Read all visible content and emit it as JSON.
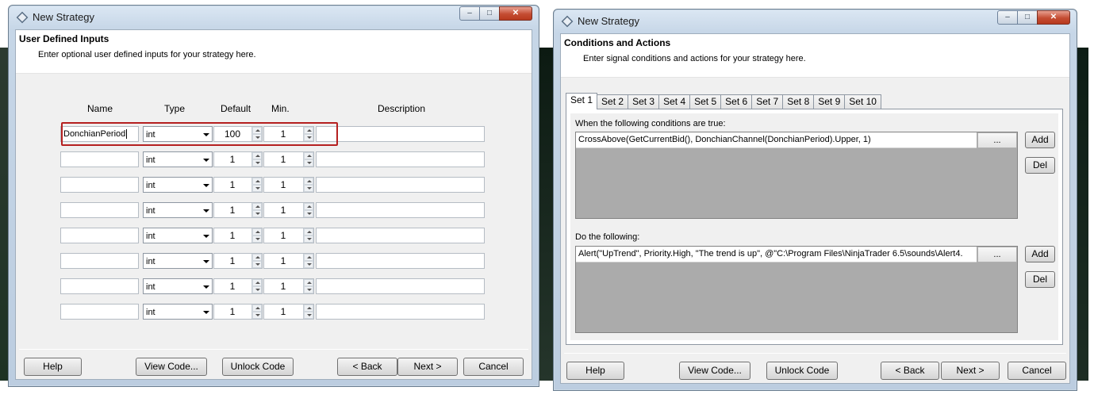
{
  "left_window": {
    "title": "New Strategy",
    "caption": {
      "minimize": "–",
      "maximize": "□",
      "close": "✕"
    },
    "header": {
      "title": "User Defined Inputs",
      "subtitle": "Enter optional user defined inputs for your strategy here."
    },
    "columns": {
      "name": "Name",
      "type": "Type",
      "default": "Default",
      "min": "Min.",
      "description": "Description"
    },
    "rows": [
      {
        "name": "DonchianPeriod",
        "type": "int",
        "default": "100",
        "min": "1",
        "description": ""
      },
      {
        "name": "",
        "type": "int",
        "default": "1",
        "min": "1",
        "description": ""
      },
      {
        "name": "",
        "type": "int",
        "default": "1",
        "min": "1",
        "description": ""
      },
      {
        "name": "",
        "type": "int",
        "default": "1",
        "min": "1",
        "description": ""
      },
      {
        "name": "",
        "type": "int",
        "default": "1",
        "min": "1",
        "description": ""
      },
      {
        "name": "",
        "type": "int",
        "default": "1",
        "min": "1",
        "description": ""
      },
      {
        "name": "",
        "type": "int",
        "default": "1",
        "min": "1",
        "description": ""
      },
      {
        "name": "",
        "type": "int",
        "default": "1",
        "min": "1",
        "description": ""
      }
    ],
    "buttons": {
      "help": "Help",
      "view_code": "View Code...",
      "unlock_code": "Unlock Code",
      "back": "< Back",
      "next": "Next >",
      "cancel": "Cancel"
    }
  },
  "right_window": {
    "title": "New Strategy",
    "caption": {
      "minimize": "–",
      "maximize": "□",
      "close": "✕"
    },
    "header": {
      "title": "Conditions and Actions",
      "subtitle": "Enter signal conditions and actions for your strategy here."
    },
    "tabs": [
      "Set 1",
      "Set 2",
      "Set 3",
      "Set 4",
      "Set 5",
      "Set 6",
      "Set 7",
      "Set 8",
      "Set 9",
      "Set 10"
    ],
    "active_tab": "Set 1",
    "conditions": {
      "label": "When the following conditions are true:",
      "items": [
        "CrossAbove(GetCurrentBid(), DonchianChannel(DonchianPeriod).Upper, 1)"
      ],
      "ellipsis": "...",
      "add": "Add",
      "del": "Del"
    },
    "actions": {
      "label": "Do the following:",
      "items": [
        "Alert(\"UpTrend\", Priority.High, \"The trend is up\", @\"C:\\Program Files\\NinjaTrader 6.5\\sounds\\Alert4."
      ],
      "ellipsis": "...",
      "add": "Add",
      "del": "Del"
    },
    "buttons": {
      "help": "Help",
      "view_code": "View Code...",
      "unlock_code": "Unlock Code",
      "back": "< Back",
      "next": "Next >",
      "cancel": "Cancel"
    }
  },
  "colors": {
    "highlight": "#b52020",
    "list_background": "#ababab",
    "window_frame": "#c6d6e7"
  }
}
